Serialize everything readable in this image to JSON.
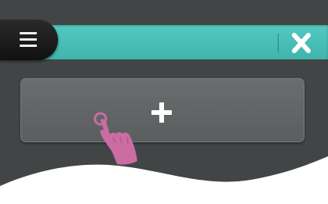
{
  "toolbar": {
    "accent_color": "#4ec2ba"
  },
  "icons": {
    "menu": "hamburger-menu-icon",
    "close": "close-x-icon",
    "add": "plus-icon",
    "gesture": "tap-hand-icon"
  },
  "theme": {
    "screen_background": "#424546",
    "button_background": "#5f6263",
    "icon_color": "#ffffff",
    "hand_color": "#cc6ca3"
  }
}
